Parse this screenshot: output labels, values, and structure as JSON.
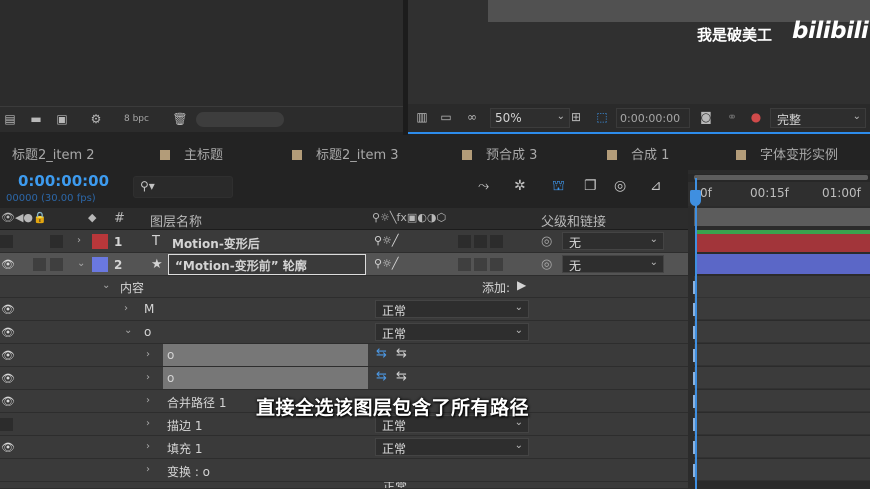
{
  "watermark": {
    "text": "我是破美工",
    "logo": "bilibili"
  },
  "project_toolbar": {
    "bpc": "8 bpc"
  },
  "viewer_toolbar": {
    "zoom": "50%",
    "timecode": "0:00:00:00",
    "quality": "完整"
  },
  "tabs": [
    {
      "label": "标题2_item 2",
      "swatch": false
    },
    {
      "label": "主标题",
      "swatch": true
    },
    {
      "label": "标题2_item 3",
      "swatch": true
    },
    {
      "label": "预合成 3",
      "swatch": true
    },
    {
      "label": "合成 1",
      "swatch": true
    },
    {
      "label": "字体变形实例",
      "swatch": true
    }
  ],
  "timeline": {
    "current_time": "0:00:00:00",
    "fps": "00000 (30.00 fps)",
    "search_placeholder": "",
    "ruler": [
      "0f",
      "00:15f",
      "01:00f"
    ]
  },
  "columns": {
    "num": "#",
    "name": "图层名称",
    "parent": "父级和链接"
  },
  "layers": [
    {
      "num": "1",
      "type_icon": "T",
      "name": "Motion-变形后",
      "color": "#b8373a",
      "parent": "无",
      "selected": false
    },
    {
      "num": "2",
      "type_icon": "★",
      "name": "“Motion-变形前” 轮廓",
      "color": "#6a78e0",
      "parent": "无",
      "selected": true
    }
  ],
  "properties": {
    "contents_label": "内容",
    "add_label": "添加:",
    "group_m": "M",
    "group_o": "o",
    "mode_normal": "正常",
    "path1": "o",
    "path2": "o",
    "merge_paths": "合并路径 1",
    "stroke": "描边 1",
    "fill": "填充 1",
    "transform": "变换 : o",
    "last_mode": "正常"
  },
  "subtitle": "直接全选该图层包含了所有路径",
  "colors": {
    "accent_blue": "#2d8ceb",
    "layer1_label": "#b8373a",
    "layer2_label": "#6a78e0",
    "tab_swatch": "#b39c79"
  }
}
